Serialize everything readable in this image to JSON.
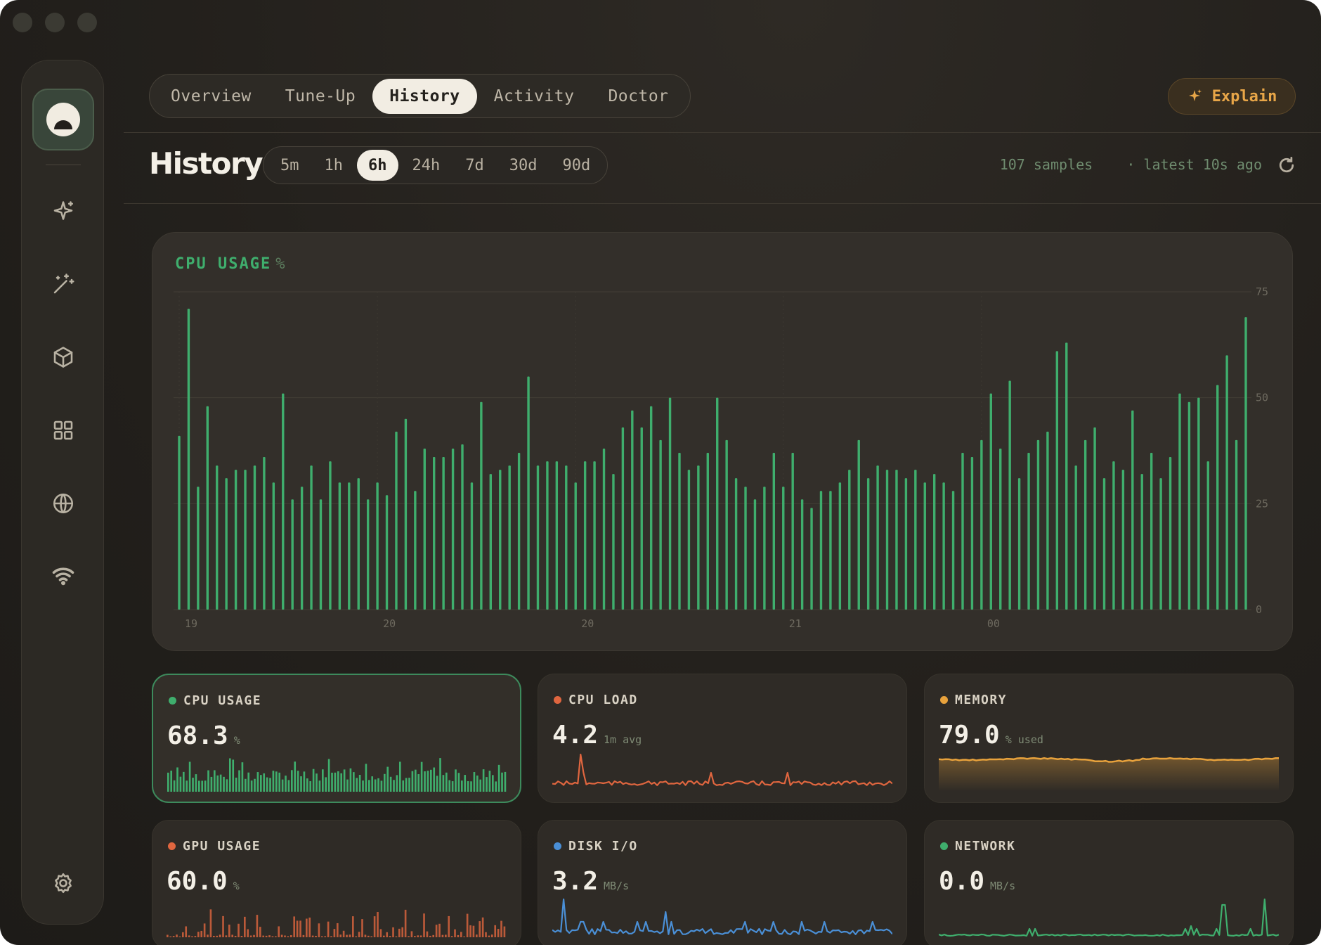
{
  "app": {
    "window_controls": [
      "close",
      "minimize",
      "zoom"
    ]
  },
  "sidebar": {
    "items": [
      {
        "name": "sparkle-icon"
      },
      {
        "name": "magic-wand-icon"
      },
      {
        "name": "package-icon"
      },
      {
        "name": "grid-icon"
      },
      {
        "name": "globe-icon"
      },
      {
        "name": "wifi-icon"
      }
    ],
    "settings": {
      "name": "gear-icon"
    }
  },
  "tabs": [
    {
      "label": "Overview",
      "active": false
    },
    {
      "label": "Tune-Up",
      "active": false
    },
    {
      "label": "History",
      "active": true
    },
    {
      "label": "Activity",
      "active": false
    },
    {
      "label": "Doctor",
      "active": false
    }
  ],
  "explain_label": "Explain",
  "page": {
    "title": "History",
    "ranges": [
      {
        "label": "5m",
        "active": false
      },
      {
        "label": "1h",
        "active": false
      },
      {
        "label": "6h",
        "active": true
      },
      {
        "label": "24h",
        "active": false
      },
      {
        "label": "7d",
        "active": false
      },
      {
        "label": "30d",
        "active": false
      },
      {
        "label": "90d",
        "active": false
      }
    ],
    "samples": "107 samples",
    "latest": "· latest 10s ago"
  },
  "chart_data": {
    "type": "bar",
    "title": "CPU USAGE",
    "unit": "%",
    "color": "#3fae6d",
    "ylim": [
      0,
      75
    ],
    "yticks": [
      0,
      25,
      50,
      75
    ],
    "grid": true,
    "x_tick_labels": [
      {
        "label": "19",
        "index": 0
      },
      {
        "label": "20",
        "index": 21
      },
      {
        "label": "20",
        "index": 42
      },
      {
        "label": "21",
        "index": 64
      },
      {
        "label": "00",
        "index": 85
      }
    ],
    "values": [
      41,
      71,
      29,
      48,
      34,
      31,
      33,
      33,
      34,
      36,
      30,
      51,
      26,
      29,
      34,
      26,
      35,
      30,
      30,
      31,
      26,
      30,
      27,
      42,
      45,
      28,
      38,
      36,
      36,
      38,
      39,
      30,
      49,
      32,
      33,
      34,
      37,
      55,
      34,
      35,
      35,
      34,
      30,
      35,
      35,
      38,
      32,
      43,
      47,
      43,
      48,
      40,
      50,
      37,
      33,
      34,
      37,
      50,
      40,
      31,
      29,
      26,
      29,
      37,
      29,
      37,
      26,
      24,
      28,
      28,
      30,
      33,
      40,
      31,
      34,
      33,
      33,
      31,
      33,
      30,
      32,
      30,
      28,
      37,
      36,
      40,
      51,
      38,
      54,
      31,
      37,
      40,
      42,
      61,
      63,
      34,
      40,
      43,
      31,
      35,
      33,
      47,
      32,
      37,
      31,
      36,
      51,
      49,
      50,
      35,
      53,
      60,
      40,
      69
    ]
  },
  "metrics": [
    {
      "label": "CPU USAGE",
      "value": "68.3",
      "unit": "%",
      "color": "#3fae6d",
      "type": "bars",
      "selected": true
    },
    {
      "label": "CPU LOAD",
      "value": "4.2",
      "unit": "1m avg",
      "color": "#e0663f",
      "type": "line",
      "selected": false
    },
    {
      "label": "MEMORY",
      "value": "79.0",
      "unit": "% used",
      "color": "#e8a23c",
      "type": "area",
      "selected": false
    },
    {
      "label": "GPU USAGE",
      "value": "60.0",
      "unit": "%",
      "color": "#e0663f",
      "type": "bars",
      "selected": false
    },
    {
      "label": "DISK I/O",
      "value": "3.2",
      "unit": "MB/s",
      "color": "#4a8fd6",
      "type": "line",
      "selected": false
    },
    {
      "label": "NETWORK",
      "value": "0.0",
      "unit": "MB/s",
      "color": "#3fae6d",
      "type": "line",
      "selected": false
    }
  ]
}
